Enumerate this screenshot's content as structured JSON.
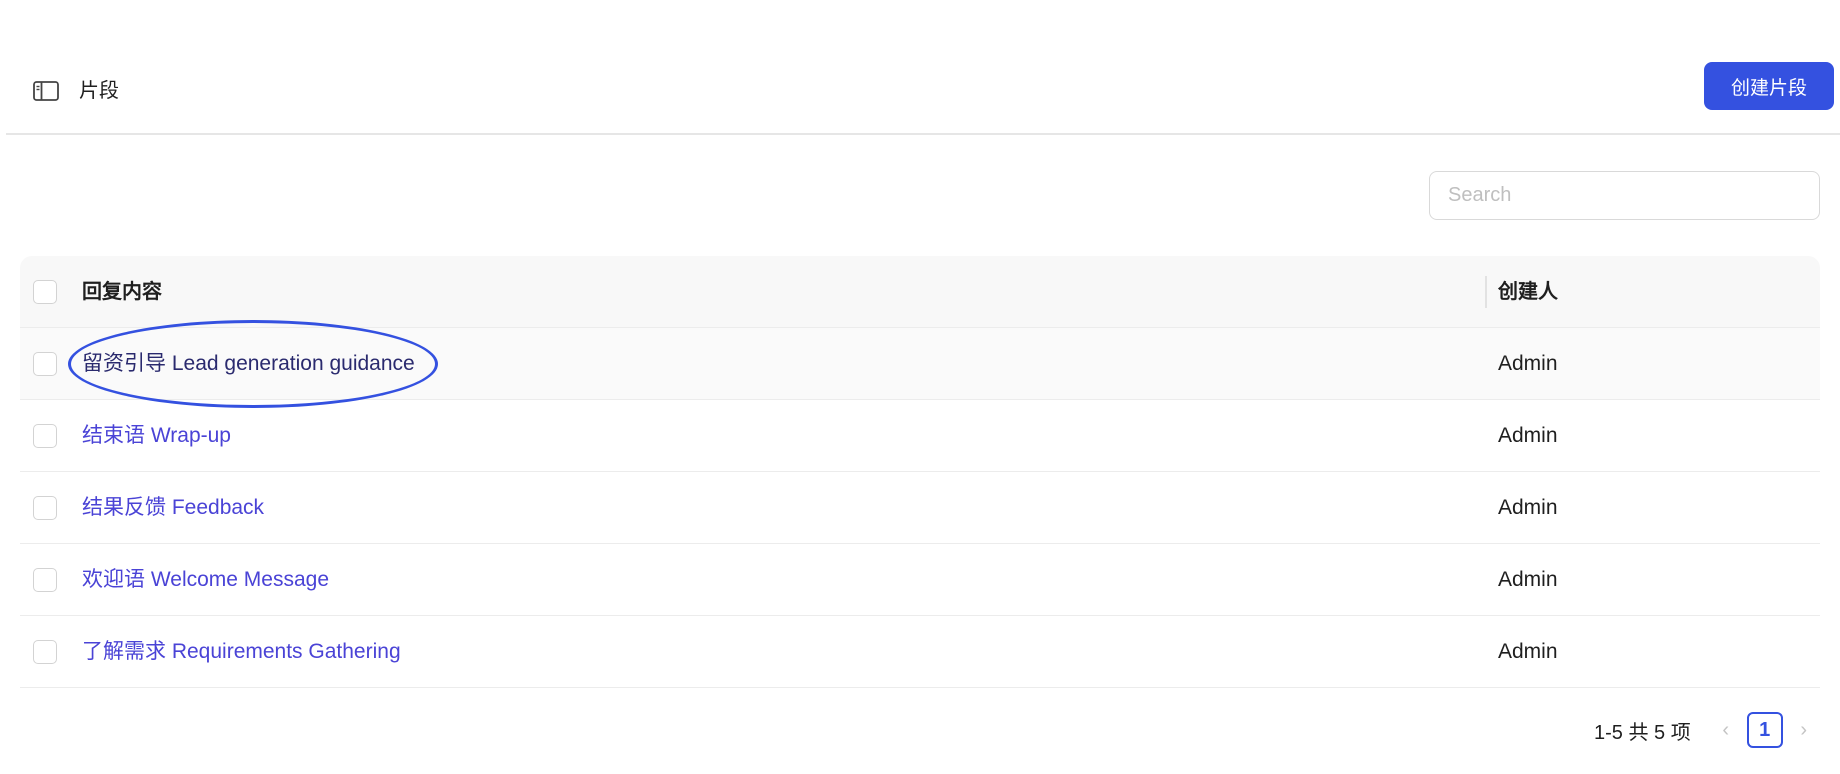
{
  "header": {
    "title": "片段",
    "sidebar_toggle_icon": "sidebar-panel-icon",
    "create_button_label": "创建片段"
  },
  "search": {
    "placeholder": "Search",
    "value": ""
  },
  "table": {
    "columns": [
      "回复内容",
      "创建人"
    ],
    "rows": [
      {
        "content": "留资引导 Lead generation guidance",
        "creator": "Admin"
      },
      {
        "content": "结束语 Wrap-up",
        "creator": "Admin"
      },
      {
        "content": "结果反馈 Feedback",
        "creator": "Admin"
      },
      {
        "content": "欢迎语 Welcome Message",
        "creator": "Admin"
      },
      {
        "content": "了解需求 Requirements Gathering",
        "creator": "Admin"
      }
    ]
  },
  "pagination": {
    "total_text": "1-5 共 5 项",
    "current_page": "1",
    "prev_icon": "chevron-left-icon",
    "next_icon": "chevron-right-icon"
  },
  "colors": {
    "accent": "#3451e0",
    "link": "#4a43d6"
  }
}
